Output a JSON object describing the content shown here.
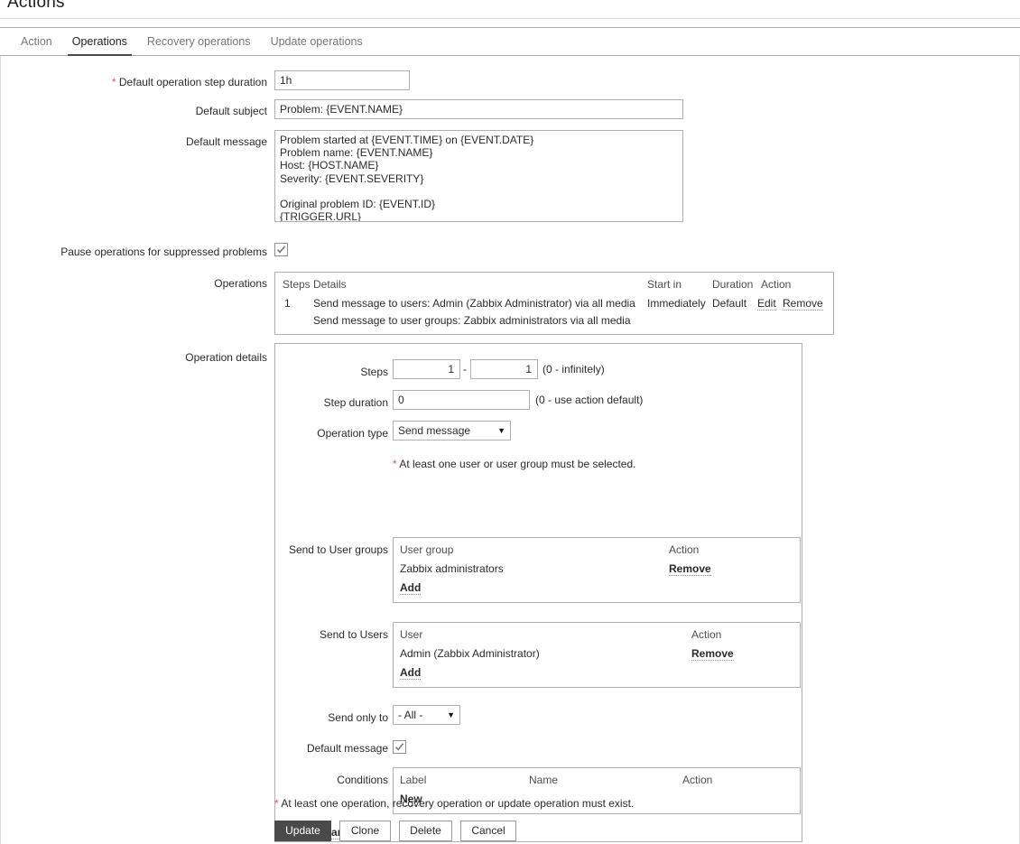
{
  "page": {
    "title": "Actions"
  },
  "tabs": [
    {
      "label": "Action",
      "active": false
    },
    {
      "label": "Operations",
      "active": true
    },
    {
      "label": "Recovery operations",
      "active": false
    },
    {
      "label": "Update operations",
      "active": false
    }
  ],
  "form": {
    "default_step_duration": {
      "label": "Default operation step duration",
      "required_marker": "*",
      "value": "1h"
    },
    "default_subject": {
      "label": "Default subject",
      "value": "Problem: {EVENT.NAME}"
    },
    "default_message": {
      "label": "Default message",
      "value": "Problem started at {EVENT.TIME} on {EVENT.DATE}\nProblem name: {EVENT.NAME}\nHost: {HOST.NAME}\nSeverity: {EVENT.SEVERITY}\n\nOriginal problem ID: {EVENT.ID}\n{TRIGGER.URL}"
    },
    "pause_suppressed": {
      "label": "Pause operations for suppressed problems",
      "checked": true
    },
    "operations": {
      "label": "Operations",
      "headers": {
        "steps": "Steps",
        "details": "Details",
        "start_in": "Start in",
        "duration": "Duration",
        "action": "Action"
      },
      "rows": [
        {
          "steps": "1",
          "detail_line1_bold": "Send message to users:",
          "detail_line1_rest": "Admin (Zabbix Administrator) via all media",
          "detail_line2_bold": "Send message to user groups:",
          "detail_line2_rest": "Zabbix administrators via all media",
          "start_in": "Immediately",
          "duration": "Default",
          "edit": "Edit",
          "remove": "Remove"
        }
      ]
    },
    "operation_details": {
      "label": "Operation details",
      "steps": {
        "label": "Steps",
        "from": "1",
        "separator": "-",
        "to": "1",
        "hint": "(0 - infinitely)"
      },
      "step_duration": {
        "label": "Step duration",
        "value": "0",
        "hint": "(0 - use action default)"
      },
      "operation_type": {
        "label": "Operation type",
        "value": "Send message",
        "caret": "▼"
      },
      "selection_note": {
        "marker": "*",
        "text": "At least one user or user group must be selected."
      },
      "send_to_user_groups": {
        "label": "Send to User groups",
        "headers": {
          "name": "User group",
          "action": "Action"
        },
        "rows": [
          {
            "name": "Zabbix administrators",
            "action": "Remove"
          }
        ],
        "add": "Add"
      },
      "send_to_users": {
        "label": "Send to Users",
        "headers": {
          "name": "User",
          "action": "Action"
        },
        "rows": [
          {
            "name": "Admin (Zabbix Administrator)",
            "action": "Remove"
          }
        ],
        "add": "Add"
      },
      "send_only_to": {
        "label": "Send only to",
        "value": "- All -",
        "caret": "▼"
      },
      "default_message": {
        "label": "Default message",
        "checked": true
      },
      "conditions": {
        "label": "Conditions",
        "headers": {
          "label": "Label",
          "name": "Name",
          "action": "Action"
        },
        "rows": [],
        "new": "New"
      },
      "actions": {
        "update": "Update",
        "cancel": "Cancel"
      }
    },
    "footer_note": {
      "marker": "*",
      "text": "At least one operation, recovery operation or update operation must exist."
    },
    "buttons": {
      "update": "Update",
      "clone": "Clone",
      "delete": "Delete",
      "cancel": "Cancel"
    }
  },
  "colors": {
    "accent_dark": "#4a4a4a",
    "required": "#d35f5f",
    "border": "#b0b0b0"
  }
}
